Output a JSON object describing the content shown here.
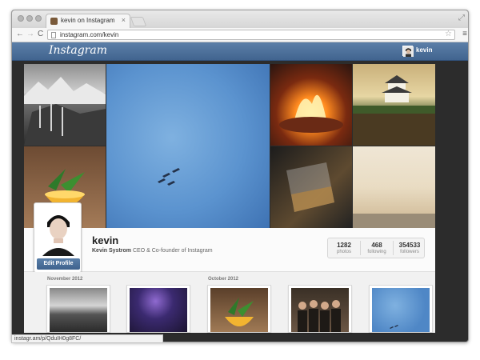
{
  "browser": {
    "tab_title": "kevin on Instagram",
    "tab_close_glyph": "×",
    "url": "instagram.com/kevin",
    "back_glyph": "←",
    "forward_glyph": "→",
    "reload_glyph": "C",
    "star_glyph": "☆",
    "menu_glyph": "≡",
    "resize_glyph": "⤢",
    "status_url": "instagr.am/p/QduIH0g8FC/"
  },
  "header": {
    "logo": "Instagram",
    "user": "kevin"
  },
  "cover": {
    "tiles": [
      "mountains-photo",
      "cocktail-photo",
      "blue-sky-jets-photo",
      "fire-pit-photo",
      "japanese-castle-photo",
      "whiskey-glass-photo",
      "beach-photo"
    ]
  },
  "profile": {
    "username": "kevin",
    "full_name": "Kevin Systrom",
    "bio": "CEO & Co-founder of Instagram",
    "edit_button": "Edit Profile",
    "stats": [
      {
        "value": "1282",
        "label": "photos"
      },
      {
        "value": "468",
        "label": "following"
      },
      {
        "value": "354533",
        "label": "followers"
      }
    ]
  },
  "feed": {
    "months": [
      "November 2012",
      "October 2012"
    ]
  },
  "colors": {
    "header_blue": "#4d709a",
    "button_blue": "#4a6f99",
    "page_dark": "#2c2c2c"
  }
}
